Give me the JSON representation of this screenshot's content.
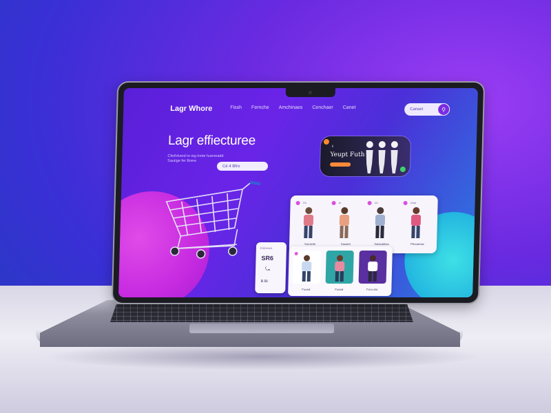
{
  "nav": {
    "logo": "Lagr Whore",
    "links": [
      "Fissh",
      "Fernche",
      "Amchinaes",
      "Cenchaer",
      "Canet"
    ],
    "search_label": "Canset",
    "search_icon": "search-icon"
  },
  "hero": {
    "title": "Lagr effiecturee",
    "subtitle": "Cltofolverd to stg trinte hueneadd Sautige fer Bnew",
    "button_label": "Cé 4 Bfro"
  },
  "promo": {
    "small_text": "ti",
    "title": "Yeupt Futh"
  },
  "product_grid": {
    "items": [
      {
        "tag": "On",
        "label": "Sronicite",
        "shirt": "#e07a8a"
      },
      {
        "tag": "ar",
        "label": "Sasater",
        "shirt": "#e8a080"
      },
      {
        "tag": "Uo",
        "label": "Salacaitiioa",
        "shirt": "#a0b0d0"
      },
      {
        "tag": "Uaar",
        "label": "Fliccaesac",
        "shirt": "#e05a80"
      }
    ]
  },
  "price_card": {
    "top": "Ksleewa",
    "value": "SR6",
    "bottom": "B Bi"
  },
  "bottom_row": {
    "items": [
      {
        "label": "Fused",
        "bg": "#ffffff",
        "shirt": "#c8d8f0"
      },
      {
        "label": "Fused",
        "bg": "#2fa6a6",
        "shirt": "#e88aa0"
      },
      {
        "label": "Furo dur",
        "bg": "#5a2fa0",
        "shirt": "#ffffff"
      }
    ]
  },
  "colors": {
    "accent": "#7a2de0",
    "screen_bg": "#5a1fd8",
    "pink_blob": "#c52ae0",
    "cyan_blob": "#23b6e0"
  }
}
